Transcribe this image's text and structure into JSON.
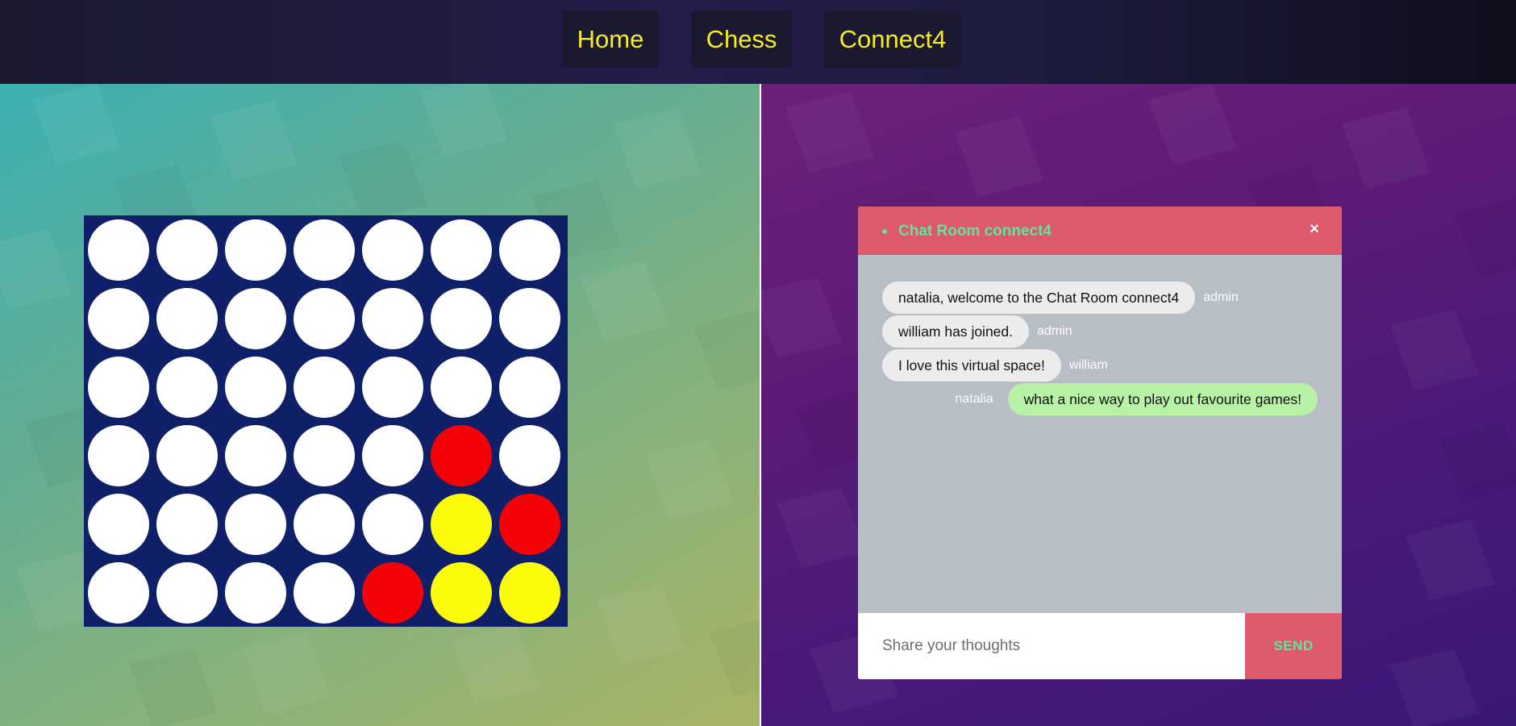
{
  "nav": {
    "items": [
      {
        "label": "Home"
      },
      {
        "label": "Chess"
      },
      {
        "label": "Connect4"
      }
    ]
  },
  "board": {
    "rows": 6,
    "cols": 7,
    "colors": {
      "empty": "#ffffff",
      "red": "#f50209",
      "yellow": "#fcfc0a",
      "board": "#0f1f68"
    },
    "cells": [
      [
        "empty",
        "empty",
        "empty",
        "empty",
        "empty",
        "empty",
        "empty"
      ],
      [
        "empty",
        "empty",
        "empty",
        "empty",
        "empty",
        "empty",
        "empty"
      ],
      [
        "empty",
        "empty",
        "empty",
        "empty",
        "empty",
        "empty",
        "empty"
      ],
      [
        "empty",
        "empty",
        "empty",
        "empty",
        "empty",
        "red",
        "empty"
      ],
      [
        "empty",
        "empty",
        "empty",
        "empty",
        "empty",
        "yellow",
        "red"
      ],
      [
        "empty",
        "empty",
        "empty",
        "empty",
        "red",
        "yellow",
        "yellow"
      ]
    ]
  },
  "chat": {
    "title": "Chat Room connect4",
    "close_label": "×",
    "messages": [
      {
        "text": "natalia, welcome to the Chat Room connect4",
        "sender": "admin",
        "mine": false
      },
      {
        "text": "william has joined.",
        "sender": "admin",
        "mine": false
      },
      {
        "text": "I love this virtual space!",
        "sender": "william",
        "mine": false
      },
      {
        "text": "what a nice way to play out favourite games!",
        "sender": "natalia",
        "mine": true
      }
    ],
    "input": {
      "placeholder": "Share your thoughts",
      "value": ""
    },
    "send_label": "SEND"
  }
}
